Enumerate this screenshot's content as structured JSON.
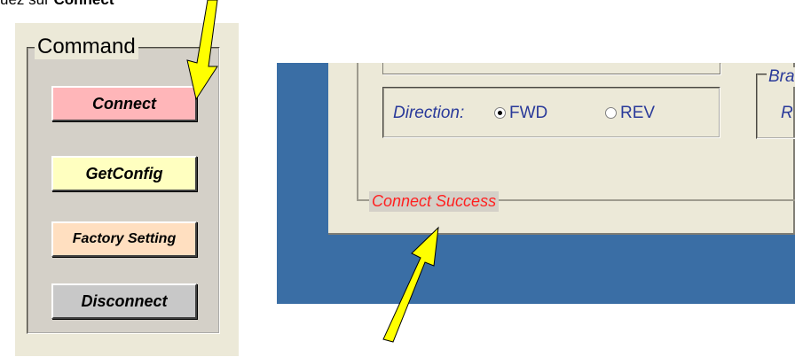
{
  "caption": {
    "prefix": "uez sur ",
    "bold": "Connect"
  },
  "command_panel": {
    "title": "Command",
    "buttons": [
      {
        "label": "Connect",
        "color": "#ffb6b9"
      },
      {
        "label": "GetConfig",
        "color": "#ffffc0"
      },
      {
        "label": "Factory Setting",
        "color": "#ffdfc0"
      },
      {
        "label": "Disconnect",
        "color": "#c8c8c8"
      }
    ]
  },
  "app_window": {
    "direction": {
      "label": "Direction:",
      "options": [
        {
          "label": "FWD",
          "selected": true
        },
        {
          "label": "REV",
          "selected": false
        }
      ]
    },
    "right_group": {
      "title": "Bra",
      "item": "R"
    },
    "status_text": "Connect Success",
    "status_color": "#ff2020",
    "desktop_color": "#3a6ea5"
  },
  "annotation_arrow_color": "#ffff00"
}
